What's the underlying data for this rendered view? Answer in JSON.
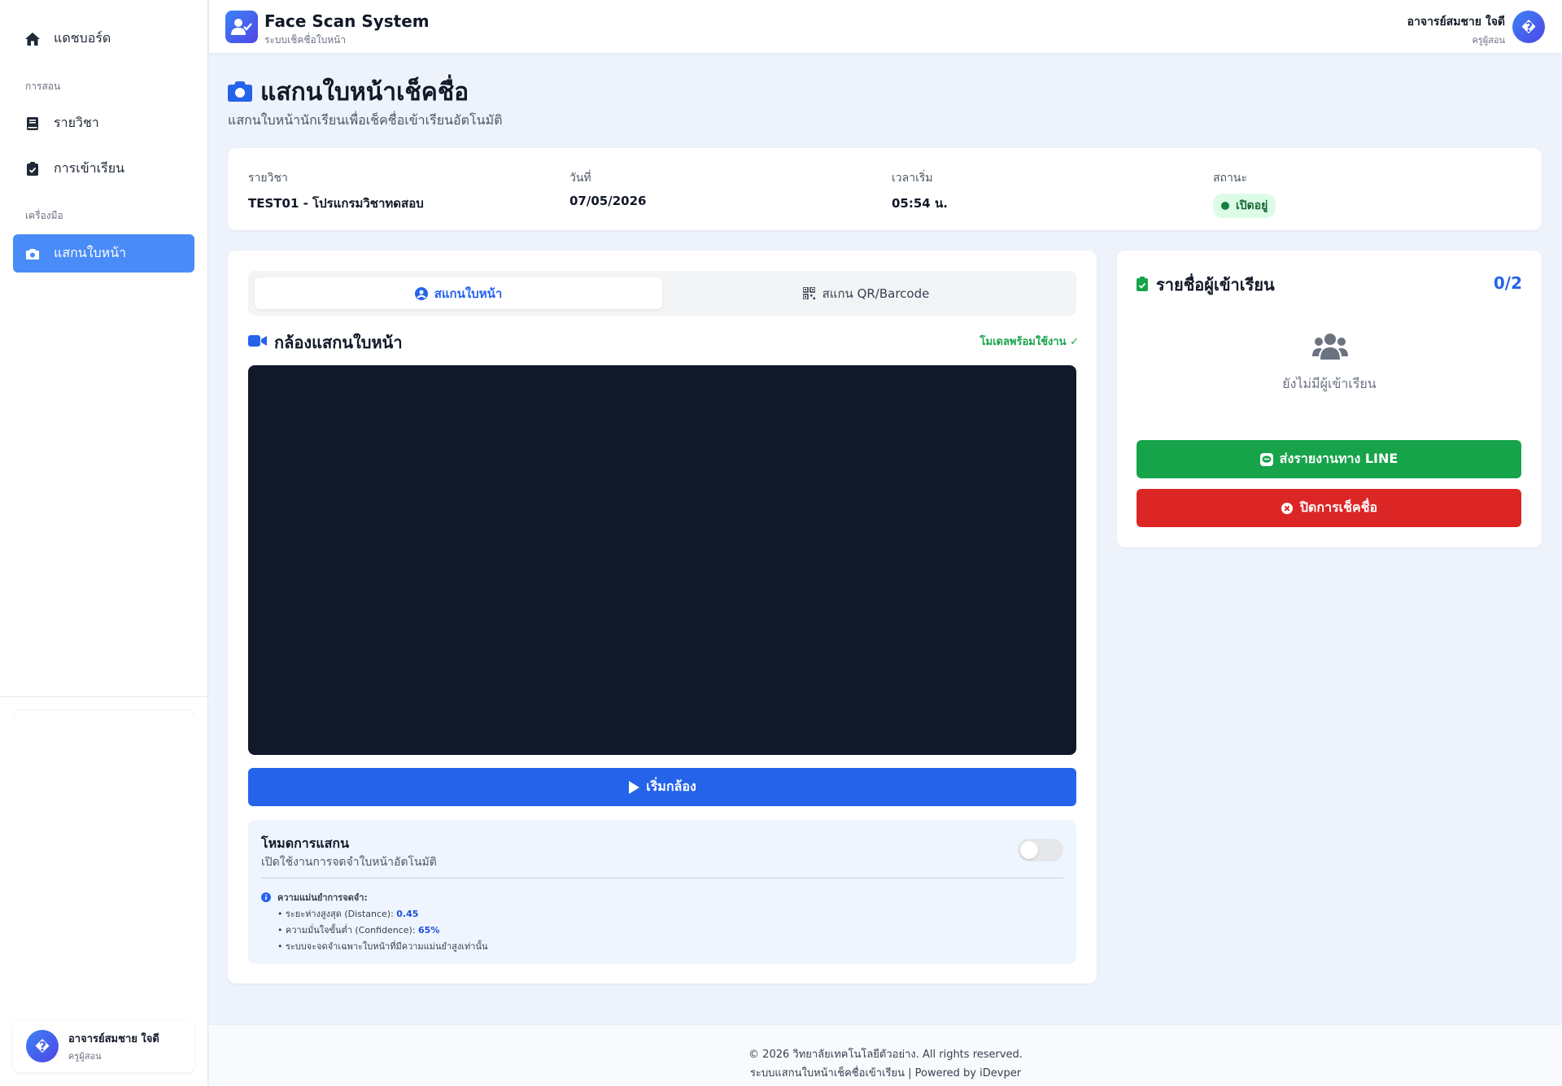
{
  "sidebar": {
    "dashboard": "แดชบอร์ด",
    "section_teaching": "การสอน",
    "courses": "รายวิชา",
    "attendance": "การเข้าเรียน",
    "section_tools": "เครื่องมือ",
    "face_scan": "แสกนใบหน้า",
    "user": {
      "avatar": "�",
      "name": "อาจารย์สมชาย ใจดี",
      "role": "ครูผู้สอน"
    }
  },
  "topbar": {
    "title": "Face Scan System",
    "subtitle": "ระบบเช็คชื่อใบหน้า",
    "user_name": "อาจารย์สมชาย ใจดี",
    "user_role": "ครูผู้สอน",
    "avatar": "�"
  },
  "page": {
    "title": "แสกนใบหน้าเช็คชื่อ",
    "subtitle": "แสกนใบหน้านักเรียนเพื่อเช็คชื่อเข้าเรียนอัตโนมัติ"
  },
  "session": {
    "course_label": "รายวิชา",
    "course_value": "TEST01 - โปรแกรมวิชาทดสอบ",
    "date_label": "วันที่",
    "date_value": "07/05/2026",
    "time_label": "เวลาเริ่ม",
    "time_value": "05:54 น.",
    "status_label": "สถานะ",
    "status_value": "เปิดอยู่"
  },
  "scanner": {
    "tab_face": "สแกนใบหน้า",
    "tab_qr": "สแกน QR/Barcode",
    "camera_title": "กล้องแสกนใบหน้า",
    "model_status": "โมเดลพร้อมใช้งาน ✓",
    "start_button": "เริ่มกล้อง",
    "mode_title": "โหมดการแสกน",
    "mode_subtitle": "เปิดใช้งานการจดจำใบหน้าอัตโนมัติ",
    "mode_enabled": false,
    "accuracy_title": "ความแม่นยำการจดจำ:",
    "distance_label": "• ระยะห่างสูงสุด (Distance): ",
    "distance_value": "0.45",
    "confidence_label": "• ความมั่นใจขั้นต่ำ (Confidence): ",
    "confidence_value": "65%",
    "note": "• ระบบจะจดจำเฉพาะใบหน้าที่มีความแม่นยำสูงเท่านั้น"
  },
  "attendance": {
    "title": "รายชื่อผู้เข้าเรียน",
    "count": "0/2",
    "empty": "ยังไม่มีผู้เข้าเรียน",
    "line_button": "ส่งรายงานทาง LINE",
    "close_button": "ปิดการเช็คชื่อ"
  },
  "footer": {
    "copyright": "© 2026 วิทยาลัยเทคโนโลยีตัวอย่าง. All rights reserved.",
    "powered": "ระบบแสกนใบหน้าเช็คชื่อเข้าเรียน | Powered by iDevper"
  },
  "colors": {
    "primary": "#2563eb",
    "sidebar_active": "#4a8cf7",
    "success": "#16a34a",
    "danger": "#dc2626",
    "video_bg": "#111827"
  }
}
